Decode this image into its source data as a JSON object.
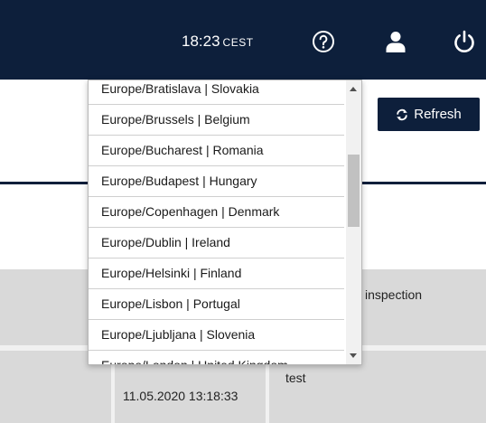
{
  "header": {
    "time": "18:23",
    "timezone": "CEST",
    "icons": [
      "help-icon",
      "user-icon",
      "power-icon"
    ]
  },
  "toolbar": {
    "refresh_label": "Refresh"
  },
  "table": {
    "row1_text": "inspection",
    "row2_text": "test",
    "row2_date": "11.05.2020 13:18:33"
  },
  "dropdown": {
    "items": [
      "Europe/Bratislava | Slovakia",
      "Europe/Brussels | Belgium",
      "Europe/Bucharest | Romania",
      "Europe/Budapest | Hungary",
      "Europe/Copenhagen | Denmark",
      "Europe/Dublin | Ireland",
      "Europe/Helsinki | Finland",
      "Europe/Lisbon | Portugal",
      "Europe/Ljubljana | Slovenia",
      "Europe/London | United Kingdom"
    ]
  },
  "colors": {
    "header_bg": "#0d1f3b",
    "row_bg": "#d9d9d9"
  }
}
